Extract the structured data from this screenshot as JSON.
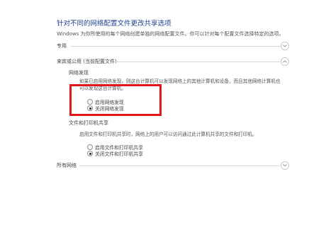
{
  "header": {
    "title": "针对不同的网络配置文件更改共享选项",
    "description": "Windows 为你所使用的每个网络创建单独的网络配置文件。你可以针对每个配置文件选择特定的选项。"
  },
  "profiles": {
    "private_label": "专用",
    "current_label": "来宾或公用 (当前配置文件)",
    "all_networks_label": "所有网络"
  },
  "network_discovery": {
    "heading": "网络发现",
    "description": "如果已启用网络发现，则这台计算机可以发现网络上的其他计算机和设备，而且其他网络计算机也可以发现这台计算机。",
    "options": [
      {
        "label": "启用网络发现",
        "selected": false
      },
      {
        "label": "关闭网络发现",
        "selected": true
      }
    ]
  },
  "file_printer_sharing": {
    "heading": "文件和打印机共享",
    "description": "启用文件和打印机共享时，网络上的用户可以访问通过此计算机共享的文件和打印机。",
    "options": [
      {
        "label": "启用文件和打印机共享",
        "selected": false
      },
      {
        "label": "关闭文件和打印机共享",
        "selected": true
      }
    ]
  },
  "colors": {
    "title": "#1f3f8f",
    "highlight_box": "#e0161a"
  },
  "icons": {
    "section_toggle": "chevron-down-icon",
    "section_toggle_expanded": "chevron-up-icon"
  }
}
